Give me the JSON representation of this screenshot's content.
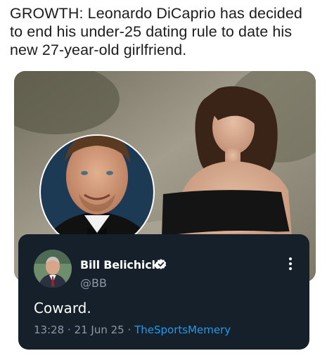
{
  "headline": "GROWTH: Leonardo DiCaprio has decided to end his under-25 dating rule to date his new 27-year-old girlfriend.",
  "tweet": {
    "display_name": "Bill Belichick",
    "handle": "@BB",
    "text": "Coward.",
    "time": "13:28",
    "separator": "·",
    "date": "21 Jun 25",
    "source": "TheSportsMemery",
    "verified": true
  },
  "icons": {
    "verified": "verified-badge-icon",
    "more": "more-options-icon"
  },
  "colors": {
    "card_background": "#15202b",
    "secondary_text": "#8b98a5",
    "link": "#1d9bf0",
    "headline_text": "#1c1c1c"
  }
}
